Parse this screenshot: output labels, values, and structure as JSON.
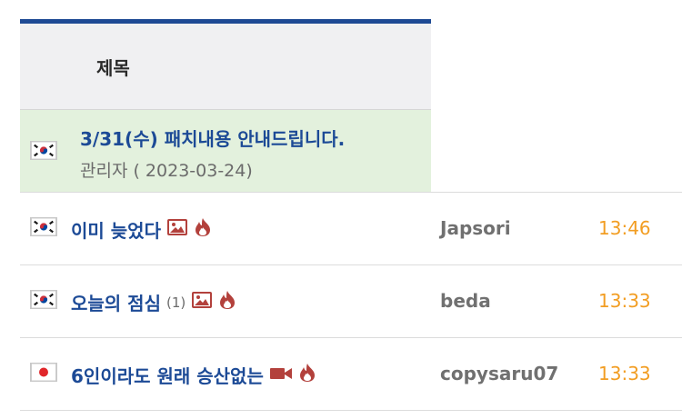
{
  "board": {
    "column_header": "제목",
    "notice": {
      "flag_icon": "korea-flag-icon",
      "title": "3/31(수) 패치내용 안내드립니다.",
      "author_date": "관리자 ( 2023-03-24)"
    },
    "rows": [
      {
        "flag_icon": "korea-flag-icon",
        "title": "이미 늦었다",
        "count": "",
        "icons": [
          "image-icon",
          "hot-fire-icon"
        ],
        "author": "Japsori",
        "time": "13:46"
      },
      {
        "flag_icon": "korea-flag-icon",
        "title": "오늘의 점심",
        "count": "(1)",
        "icons": [
          "image-icon",
          "hot-fire-icon"
        ],
        "author": "beda",
        "time": "13:33"
      },
      {
        "flag_icon": "japan-flag-icon",
        "title": "6인이라도 원래 승산없는",
        "count": "",
        "icons": [
          "video-icon",
          "hot-fire-icon"
        ],
        "author": "copysaru07",
        "time": "13:33"
      }
    ]
  },
  "colors": {
    "header_bar": "#1e4a94",
    "title_link": "#1c4a96",
    "notice_bg": "#e3f1dd",
    "time": "#f29d22",
    "icon_red": "#b3413c"
  }
}
